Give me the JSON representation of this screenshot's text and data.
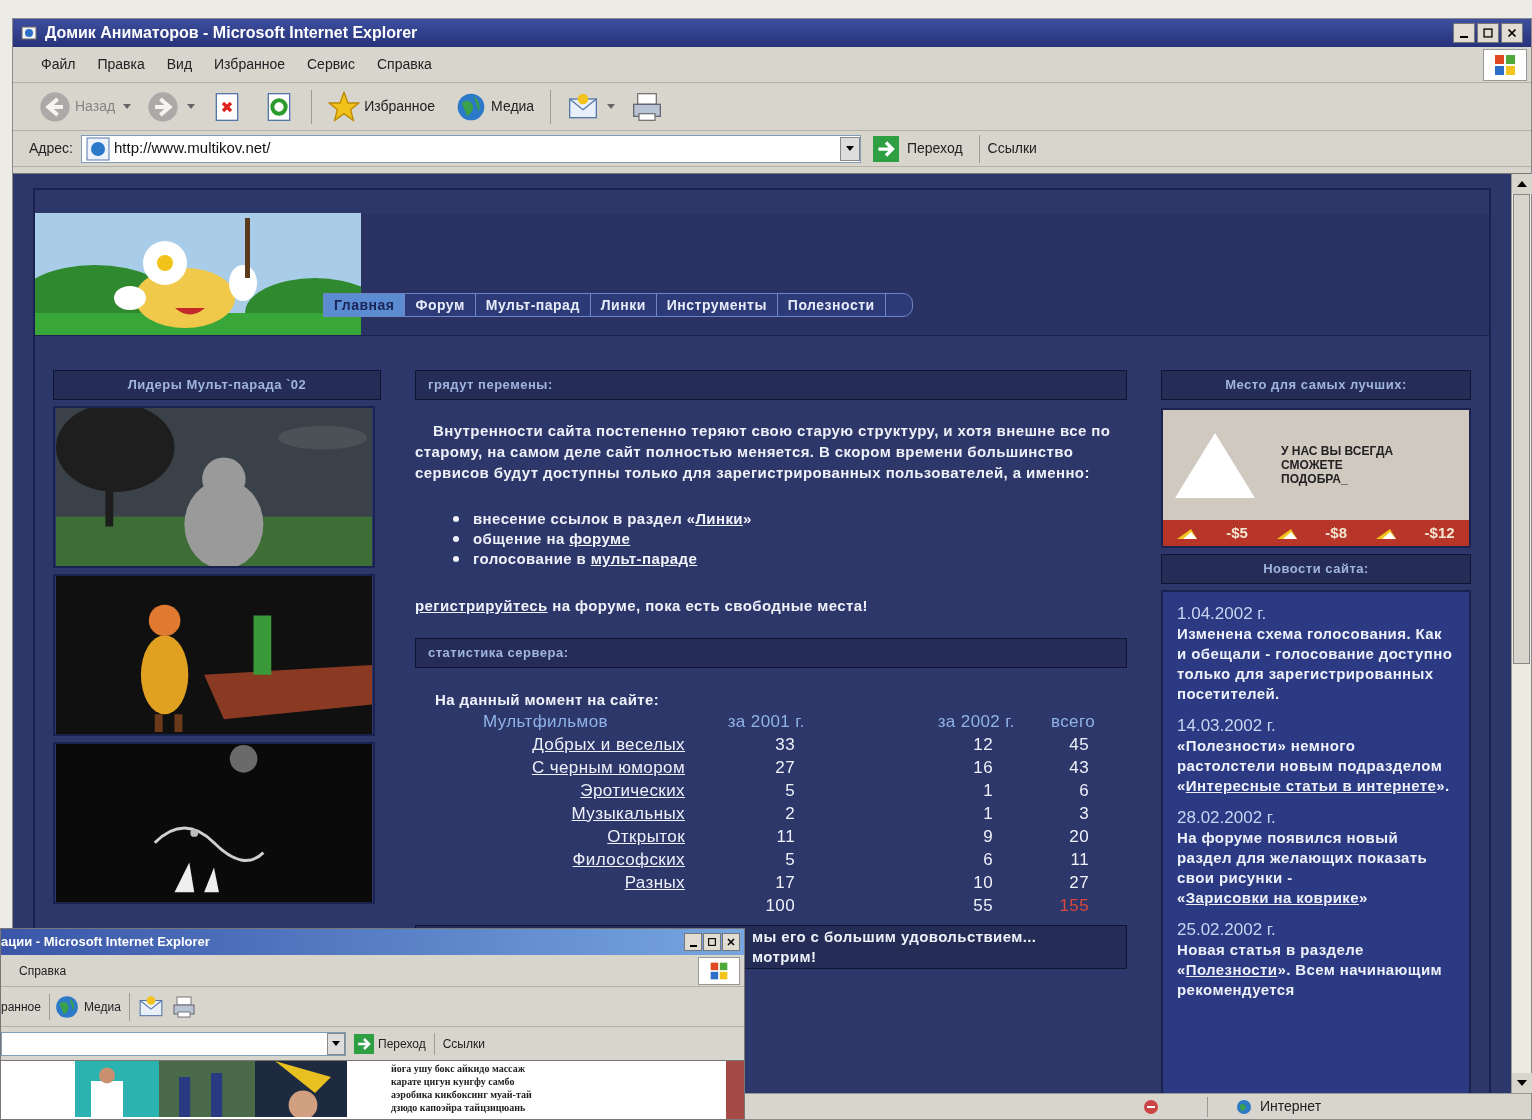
{
  "window": {
    "title": "Домик Аниматоров - Microsoft Internet Explorer"
  },
  "menu": [
    "Файл",
    "Правка",
    "Вид",
    "Избранное",
    "Сервис",
    "Справка"
  ],
  "toolbar": [
    {
      "kind": "back",
      "label": "Назад",
      "disabled": true
    },
    {
      "kind": "forward",
      "disabled": true
    },
    {
      "kind": "stop",
      "disabled": false
    },
    {
      "kind": "refresh",
      "disabled": false
    },
    {
      "kind": "favorites",
      "label": "Избранное",
      "disabled": false
    },
    {
      "kind": "media",
      "label": "Медиа",
      "disabled": false
    },
    {
      "kind": "mail",
      "disabled": false
    },
    {
      "kind": "print",
      "disabled": false
    }
  ],
  "address": {
    "label": "Адрес:",
    "value": "http://www.multikov.net/",
    "go": "Переход",
    "links": "Ссылки"
  },
  "nav": [
    {
      "label": "Главная",
      "selected": true
    },
    {
      "label": "Форум",
      "selected": false
    },
    {
      "label": "Мульт-парад",
      "selected": false
    },
    {
      "label": "Линки",
      "selected": false
    },
    {
      "label": "Инструменты",
      "selected": false
    },
    {
      "label": "Полезности",
      "selected": false
    }
  ],
  "leaders": {
    "title": "Лидеры Мульт-парада `02"
  },
  "changes": {
    "title": "грядут перемены:",
    "intro": "Внутренности сайта постепенно теряют свою старую структуру, и хотя внешне все по старому, на самом деле сайт полностью меняется. В скором времени большинство сервисов будут доступны только для зарегистрированных пользователей, а именно:",
    "bullets": [
      [
        {
          "text": "внесение ссылок в раздел «"
        },
        {
          "text": "Линки",
          "link": true
        },
        {
          "text": "»"
        }
      ],
      [
        {
          "text": "общение на "
        },
        {
          "text": "форуме",
          "link": true
        }
      ],
      [
        {
          "text": "голосование в "
        },
        {
          "text": "мульт-параде",
          "link": true
        }
      ]
    ],
    "footer": [
      {
        "text": "регистрируйтесь",
        "link": true
      },
      {
        "text": " на форуме, пока есть свободные места!"
      }
    ]
  },
  "stats": {
    "title": "статистика сервера:",
    "caption": "На данный момент на сайте:",
    "columns": [
      "Мультфильмов",
      "за 2001 г.",
      "за 2002 г.",
      "всего"
    ],
    "rows": [
      {
        "label": "Добрых и веселых",
        "values": [
          "33",
          "12",
          "45"
        ],
        "highlight": false
      },
      {
        "label": "С черным юмором",
        "values": [
          "27",
          "16",
          "43"
        ],
        "highlight": false
      },
      {
        "label": "Эротических",
        "values": [
          "5",
          "1",
          "6"
        ],
        "highlight": false
      },
      {
        "label": "Музыкальных",
        "values": [
          "2",
          "1",
          "3"
        ],
        "highlight": false
      },
      {
        "label": "Открыток",
        "values": [
          "11",
          "9",
          "20"
        ],
        "highlight": false
      },
      {
        "label": "Философских",
        "values": [
          "5",
          "6",
          "11"
        ],
        "highlight": false
      },
      {
        "label": "Разных",
        "values": [
          "17",
          "10",
          "27"
        ],
        "highlight": false
      },
      {
        "values": [
          "100",
          "55",
          "155"
        ],
        "highlight": true
      }
    ]
  },
  "quote": {
    "lines": [
      "мы его с большим удовольствием...",
      "мотрим!"
    ]
  },
  "ad_title": "Место для самых лучших:",
  "ad": {
    "lines": [
      "У НАС ВЫ ВСЕГДА",
      "СМОЖЕТЕ",
      "ПОДОБРА_"
    ],
    "prices": [
      "-$5",
      "-$8",
      "-$12"
    ]
  },
  "news_title": "Новости сайта:",
  "news": [
    {
      "date": "1.04.2002 г.",
      "body": [
        {
          "text": "Изменена схема голосования. Как и обещали - голосование доступно только для зарегистрированных посетителей."
        }
      ]
    },
    {
      "date": "14.03.2002 г.",
      "body": [
        {
          "text": "«Полезности» немного растолстели новым подразделом «"
        },
        {
          "text": "Интересные статьи в интернете",
          "link": true
        },
        {
          "text": "»."
        }
      ]
    },
    {
      "date": "28.02.2002 г.",
      "body": [
        {
          "text": "На форуме появился новый раздел для желающих показать свои рисунки - «"
        },
        {
          "text": "Зарисовки на коврике",
          "link": true
        },
        {
          "text": "»"
        }
      ]
    },
    {
      "date": "25.02.2002 г.",
      "body": [
        {
          "text": "Новая статья в разделе «"
        },
        {
          "text": "Полезности",
          "link": true
        },
        {
          "text": "». Всем начинающим рекомендуется"
        }
      ]
    }
  ],
  "status_bar": {
    "zone": "Интернет"
  },
  "popup": {
    "title": "ации - Microsoft Internet Explorer",
    "menu": [
      "Справка"
    ],
    "toolbar": [
      "ранное",
      "Медиа"
    ],
    "go": "Переход",
    "links": "Ссылки",
    "text_lines": [
      "йога ушу бокс айкидо массаж",
      "карате цигун кунгфу самбо",
      "аэробика кикбоксинг муай-тай",
      "дзюдо капоэйра тайцзицюань"
    ]
  }
}
